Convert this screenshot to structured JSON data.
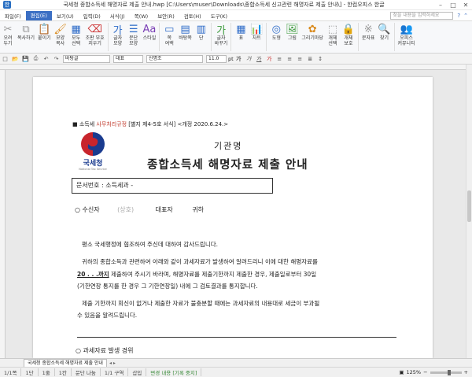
{
  "window": {
    "title": "국세청 종합소득세 해명자료 제출 안내.hwp [C:\\Users\\muser\\Downloads\\종합소득세 신고관련 해명자료 제출 안내\\] - 한컴오피스 한글",
    "minimize": "–",
    "maximize": "□",
    "close": "✕"
  },
  "menu": {
    "items": [
      "파일(F)",
      "편집(E)",
      "보기(U)",
      "입력(D)",
      "서식(J)",
      "쪽(W)",
      "보안(R)",
      "검토(H)",
      "도구(K)"
    ],
    "active_index": 1,
    "search_placeholder": "찾을 내용을 입력하세요"
  },
  "ribbon": {
    "buttons": [
      {
        "label": "오려\n두기",
        "icon": "scissors-icon",
        "glyph": "✂",
        "color": "gray"
      },
      {
        "label": "복사하기",
        "icon": "copy-icon",
        "glyph": "⧉",
        "color": "gray"
      },
      {
        "label": "붙이기",
        "icon": "paste-icon",
        "glyph": "📋",
        "color": "orange"
      },
      {
        "label": "모양\n복사",
        "icon": "format-painter-icon",
        "glyph": "🖌",
        "color": "orange"
      },
      {
        "label": "모두\n선택",
        "icon": "select-all-icon",
        "glyph": "▦",
        "color": "blue"
      },
      {
        "label": "조판 부호\n지우기",
        "icon": "clear-codes-icon",
        "glyph": "⌫",
        "color": "red"
      },
      {
        "label": "글자\n모양",
        "icon": "char-shape-icon",
        "glyph": "가",
        "color": "blue"
      },
      {
        "label": "문단\n모양",
        "icon": "para-shape-icon",
        "glyph": "☰",
        "color": "blue"
      },
      {
        "label": "스타일",
        "icon": "style-icon",
        "glyph": "Aa",
        "color": "purple"
      },
      {
        "label": "쪽\n여백",
        "icon": "page-margin-icon",
        "glyph": "▭",
        "color": "blue"
      },
      {
        "label": "바탕쪽",
        "icon": "master-page-icon",
        "glyph": "▤",
        "color": "blue"
      },
      {
        "label": "단",
        "icon": "columns-icon",
        "glyph": "▥",
        "color": "blue"
      },
      {
        "label": "글자\n바꾸기",
        "icon": "replace-char-icon",
        "glyph": "가",
        "color": "green"
      },
      {
        "label": "표",
        "icon": "table-icon",
        "glyph": "▦",
        "color": "blue"
      },
      {
        "label": "차트",
        "icon": "chart-icon",
        "glyph": "📊",
        "color": "orange"
      },
      {
        "label": "도형",
        "icon": "shape-icon",
        "glyph": "◎",
        "color": "blue"
      },
      {
        "label": "그림",
        "icon": "picture-icon",
        "glyph": "🖼",
        "color": "green"
      },
      {
        "label": "그리기마당",
        "icon": "clipart-icon",
        "glyph": "✿",
        "color": "orange"
      },
      {
        "label": "개체\n선택",
        "icon": "object-select-icon",
        "glyph": "⬚",
        "color": "gray"
      },
      {
        "label": "개체\n보호",
        "icon": "object-protect-icon",
        "glyph": "🔒",
        "color": "gray"
      },
      {
        "label": "문자표",
        "icon": "symbol-icon",
        "glyph": "※",
        "color": "gray"
      },
      {
        "label": "찾기",
        "icon": "find-icon",
        "glyph": "🔍",
        "color": "blue"
      },
      {
        "label": "오피스\n커뮤니티",
        "icon": "community-icon",
        "glyph": "👥",
        "color": "blue"
      }
    ]
  },
  "formatbar": {
    "style": "바탕글",
    "font_lang": "대표",
    "font": "신명조",
    "size": "11.0",
    "size_unit": "pt"
  },
  "document": {
    "form_ref_prefix": "소득세 ",
    "form_ref_rule": "사무처리규정",
    "form_ref_suffix": " [별지 제4-5호 서식] <개정 2020.6.24.>",
    "logo_name": "국세청",
    "logo_sub": "National Tax Service",
    "agency": "기관명",
    "title": "종합소득세 해명자료 제출 안내",
    "doc_number": "문서번호 : 소득세과 -",
    "recipient_label": "○ 수신자",
    "recipient_faded": "(상호)",
    "recipient_rep": "대표자",
    "recipient_honorific": "귀하",
    "greeting": "평소 국세행정에 협조하여 주신데 대하여 감사드립니다.",
    "p2_line1": "귀하의 종합소득과 관련하여 아래와 같이 과세자료가 발생하여 알려드리니 이에 대한 해명자료를",
    "p2_date": "20 .   .   .까지",
    "p2_line2_rest": " 제출하여 주시기 바라며, 해명자료를 제출기한까지 제출한 경우, 제출일로부터 30일",
    "p2_line3": "(기한연장 통지를 한 경우 그 기한연장일) 내에 그 검토결과를 통지합니다.",
    "p3_line1": "제출 기한까지 회신이 없거나 제출한 자료가 불충분할 때에는 과세자료의 내용대로 세금이 부과될",
    "p3_line2": "수 있음을 알려드립니다.",
    "section1": "○ 과세자료 발생 경위"
  },
  "status": {
    "doc_tab": "국세청 종합소득세 해명자료 제출 안내",
    "page": "1/1쪽",
    "section": "1단",
    "line": "1줄",
    "col": "1칸",
    "para": "문단 나눔",
    "area": "1/1 구역",
    "insert": "삽입",
    "track": "변경 내용 [기록 중지]",
    "zoom": "125%"
  }
}
